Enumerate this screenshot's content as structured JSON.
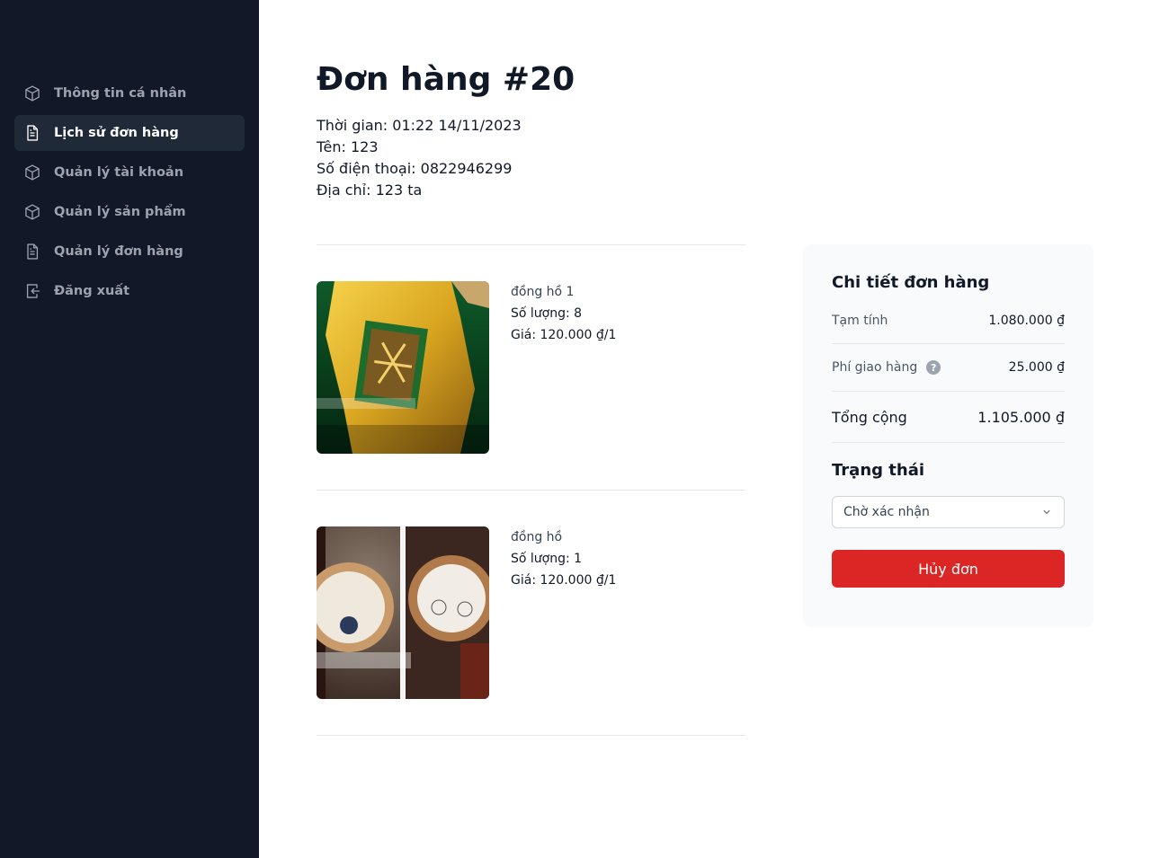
{
  "sidebar": {
    "items": [
      {
        "label": "Thông tin cá nhân",
        "icon": "cube-icon",
        "active": false
      },
      {
        "label": "Lịch sử đơn hàng",
        "icon": "document-icon",
        "active": true
      },
      {
        "label": "Quản lý tài khoản",
        "icon": "cube-icon",
        "active": false
      },
      {
        "label": "Quản lý sản phẩm",
        "icon": "cube-icon",
        "active": false
      },
      {
        "label": "Quản lý đơn hàng",
        "icon": "document-icon",
        "active": false
      },
      {
        "label": "Đăng xuất",
        "icon": "logout-icon",
        "active": false
      }
    ]
  },
  "order": {
    "title": "Đơn hàng #20",
    "time": "Thời gian: 01:22 14/11/2023",
    "name": "Tên: 123",
    "phone": "Số điện thoại: 0822946299",
    "address": "Địa chỉ: 123 ta"
  },
  "items": [
    {
      "name": "đồng hồ 1",
      "quantity": "Số lượng: 8",
      "price": "Giá: 120.000 ₫/1",
      "image": "gold-watch-image"
    },
    {
      "name": "đồng hồ",
      "quantity": "Số lượng: 1",
      "price": "Giá: 120.000 ₫/1",
      "image": "rose-gold-watch-image"
    }
  ],
  "summary": {
    "title": "Chi tiết đơn hàng",
    "subtotal_label": "Tạm tính",
    "subtotal_value": "1.080.000 ₫",
    "shipping_label": "Phí giao hàng",
    "shipping_value": "25.000 ₫",
    "total_label": "Tổng cộng",
    "total_value": "1.105.000 ₫",
    "status_title": "Trạng thái",
    "status_selected": "Chờ xác nhận",
    "cancel_label": "Hủy đơn"
  },
  "colors": {
    "sidebar_bg": "#111827",
    "active_bg": "#1f2937",
    "cancel_button": "#dc2626",
    "summary_bg": "#f9fafb"
  }
}
